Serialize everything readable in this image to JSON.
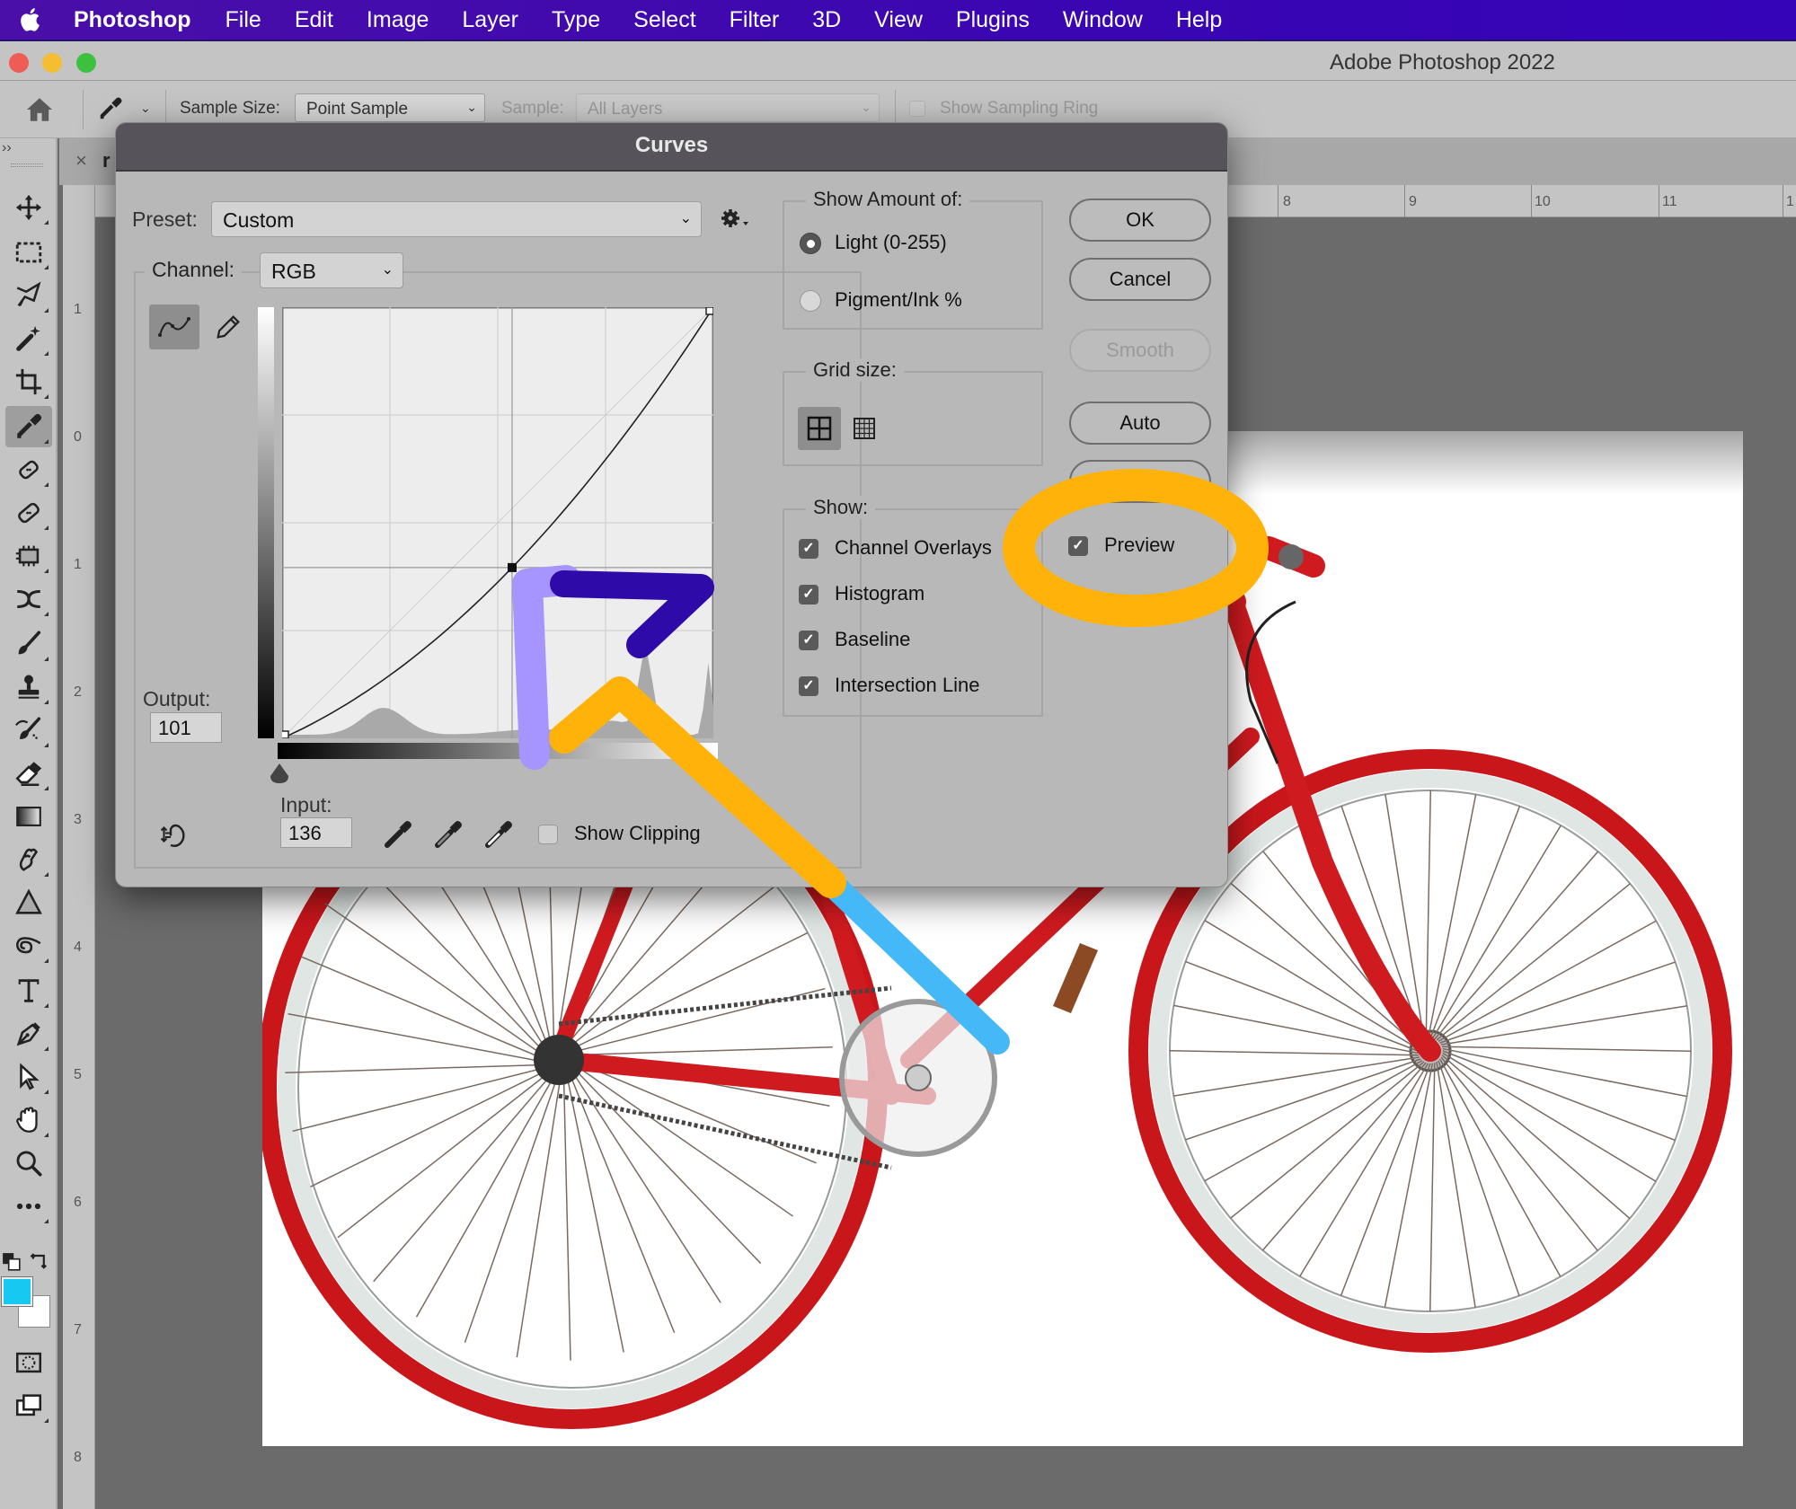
{
  "menubar": {
    "app_name": "Photoshop",
    "items": [
      "File",
      "Edit",
      "Image",
      "Layer",
      "Type",
      "Select",
      "Filter",
      "3D",
      "View",
      "Plugins",
      "Window",
      "Help"
    ]
  },
  "window": {
    "title": "Adobe Photoshop 2022"
  },
  "options_bar": {
    "sample_size_label": "Sample Size:",
    "sample_size_value": "Point Sample",
    "sample_label": "Sample:",
    "sample_value": "All Layers",
    "show_sampling_ring_label": "Show Sampling Ring",
    "show_sampling_ring_checked": false
  },
  "toolbar": {
    "collapse_label": "››",
    "active_tool": "eyedropper-tool",
    "foreground_color": "#17c8f0",
    "background_color": "#ffffff",
    "tools": [
      "move",
      "marquee",
      "lasso",
      "magic-wand",
      "crop",
      "eyedropper",
      "spot-healing",
      "healing",
      "patch",
      "content-aware-move",
      "brush",
      "clone-stamp",
      "history-brush",
      "eraser",
      "gradient",
      "smudge",
      "blur-triangle",
      "dodge",
      "type",
      "pen",
      "path-selection",
      "hand",
      "zoom",
      "more"
    ]
  },
  "document": {
    "tab_name": "r",
    "ruler_top_labels": [
      "8",
      "9",
      "10",
      "11",
      "1"
    ],
    "ruler_left_labels": [
      "1",
      "0",
      "1",
      "2",
      "3",
      "4",
      "5",
      "6",
      "7",
      "8"
    ]
  },
  "curves_dialog": {
    "title": "Curves",
    "preset_label": "Preset:",
    "preset_value": "Custom",
    "channel_label": "Channel:",
    "channel_value": "RGB",
    "output_label": "Output:",
    "output_value": "101",
    "input_label": "Input:",
    "input_value": "136",
    "show_clipping_label": "Show Clipping",
    "show_clipping_checked": false,
    "curve_points": [
      [
        0,
        0
      ],
      [
        136,
        101
      ],
      [
        255,
        255
      ]
    ],
    "show_amount": {
      "legend": "Show Amount of:",
      "options": [
        {
          "label": "Light  (0-255)",
          "selected": true
        },
        {
          "label": "Pigment/Ink %",
          "selected": false
        }
      ]
    },
    "grid_size": {
      "legend": "Grid size:",
      "selected": "simple"
    },
    "show": {
      "legend": "Show:",
      "options": [
        {
          "label": "Channel Overlays",
          "checked": true
        },
        {
          "label": "Histogram",
          "checked": true
        },
        {
          "label": "Baseline",
          "checked": true
        },
        {
          "label": "Intersection Line",
          "checked": true
        }
      ]
    },
    "buttons": {
      "ok": "OK",
      "cancel": "Cancel",
      "smooth": "Smooth",
      "auto": "Auto",
      "options": ""
    },
    "preview_label": "Preview",
    "preview_checked": true
  },
  "annotations": {
    "highlight_color": "#ffb20a",
    "arrow_dark": "#2e0aa8",
    "arrow_light": "#a694ff",
    "arrow_cyan": "#45b8f7"
  }
}
